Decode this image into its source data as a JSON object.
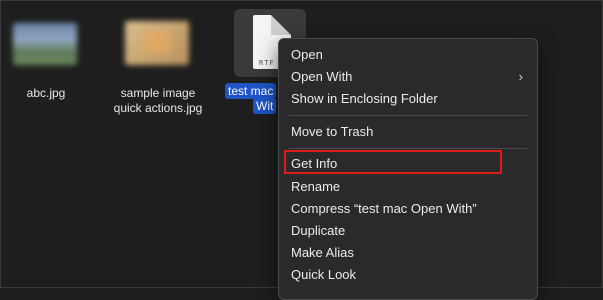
{
  "files": {
    "abc": {
      "label": "abc.jpg"
    },
    "sample": {
      "label_line1": "sample image",
      "label_line2": "quick actions.jpg"
    },
    "selected": {
      "label_line1": "test mac",
      "label_line2": "Wit",
      "doc_tag": "RTF"
    }
  },
  "context_menu": {
    "items": [
      {
        "label": "Open"
      },
      {
        "label": "Open With",
        "submenu_icon": "chevron-right-icon",
        "arrow": "›"
      },
      {
        "label": "Show in Enclosing Folder"
      },
      {
        "label": "Move to Trash"
      },
      {
        "label": "Get Info"
      },
      {
        "label": "Rename"
      },
      {
        "label": "Compress “test mac Open With”"
      },
      {
        "label": "Duplicate"
      },
      {
        "label": "Make Alias"
      },
      {
        "label": "Quick Look"
      }
    ]
  },
  "colors": {
    "background": "#1e1e1e",
    "menu_bg": "#2a2a2c",
    "selection_blue": "#1f55c6",
    "highlight_red": "#e01a1a"
  }
}
